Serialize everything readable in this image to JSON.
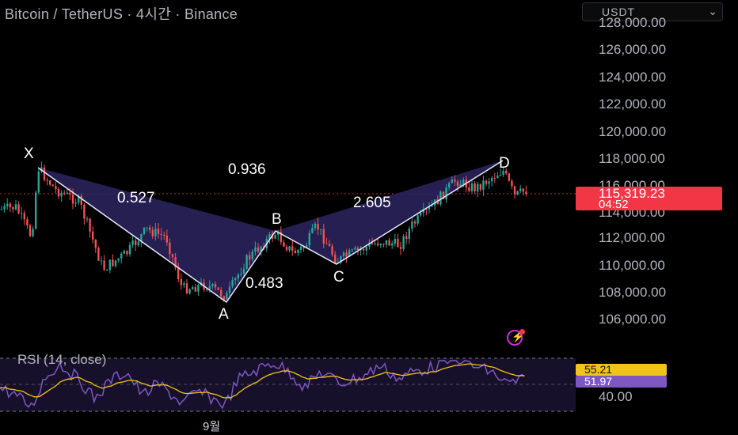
{
  "header": {
    "title": "Bitcoin / TetherUS · 4시간 · Binance",
    "currency_selector": "USDT",
    "currency_chevron": "⌄"
  },
  "price_axis": {
    "ticks": [
      "128,000.00",
      "126,000.00",
      "124,000.00",
      "122,000.00",
      "120,000.00",
      "118,000.00",
      "116,000.00",
      "114,000.00",
      "112,000.00",
      "110,000.00",
      "108,000.00",
      "106,000.00"
    ],
    "current_price": "115,319.23",
    "countdown": "04:52"
  },
  "pattern": {
    "points": {
      "x": "X",
      "a": "A",
      "b": "B",
      "c": "C",
      "d": "D"
    },
    "ratios": {
      "xb": "0.527",
      "xd": "0.936",
      "ac": "0.483",
      "bd": "2.605"
    },
    "fill_color": "#2d2560",
    "line_color": "#e8e8ff"
  },
  "rsi": {
    "label": "RSI (14, close)",
    "level": "40.00",
    "value_signal": "55.21",
    "value_rsi": "51.97",
    "rsi_color": "#7e57c2",
    "signal_color": "#f0c419"
  },
  "time_axis": {
    "month_label": "9월"
  },
  "colors": {
    "up": "#26a69a",
    "down": "#ef5350",
    "price_tag": "#f23645"
  },
  "icons": {
    "flash": "lightning-icon"
  }
}
